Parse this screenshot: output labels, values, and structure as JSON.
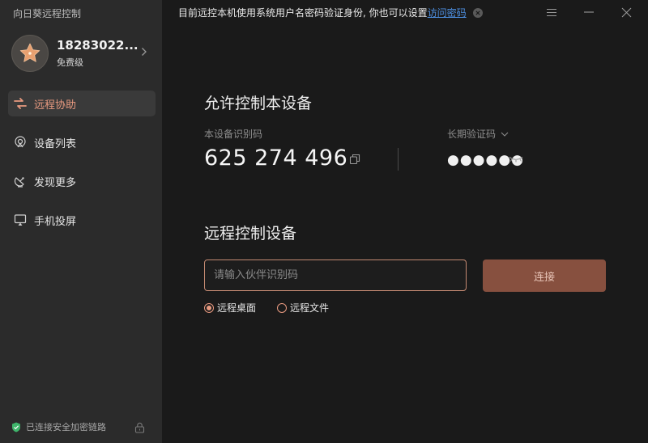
{
  "app": {
    "title": "向日葵远程控制"
  },
  "profile": {
    "name": "18283022...",
    "tier": "免费级"
  },
  "nav": {
    "items": [
      {
        "label": "远程协助",
        "icon": "remote-assist-icon",
        "active": true
      },
      {
        "label": "设备列表",
        "icon": "device-list-icon",
        "active": false
      },
      {
        "label": "发现更多",
        "icon": "discover-icon",
        "active": false
      },
      {
        "label": "手机投屏",
        "icon": "screen-cast-icon",
        "active": false
      }
    ]
  },
  "security": {
    "status": "已连接安全加密链路"
  },
  "notice": {
    "text": "目前远控本机使用系统用户名密码验证身份, 你也可以设置",
    "link": "访问密码"
  },
  "allow": {
    "title": "允许控制本设备",
    "device_code_label": "本设备识别码",
    "device_code": "625 274 496",
    "verify_label": "长期验证码",
    "verify_masked": "●●●●●●"
  },
  "remote": {
    "title": "远程控制设备",
    "input_placeholder": "请输入伙伴识别码",
    "connect_label": "连接",
    "modes": [
      {
        "label": "远程桌面",
        "selected": true
      },
      {
        "label": "远程文件",
        "selected": false
      }
    ]
  },
  "colors": {
    "accent": "#e89a80",
    "button": "#87503f",
    "link": "#4d8fe0",
    "secure": "#3fb56b"
  }
}
